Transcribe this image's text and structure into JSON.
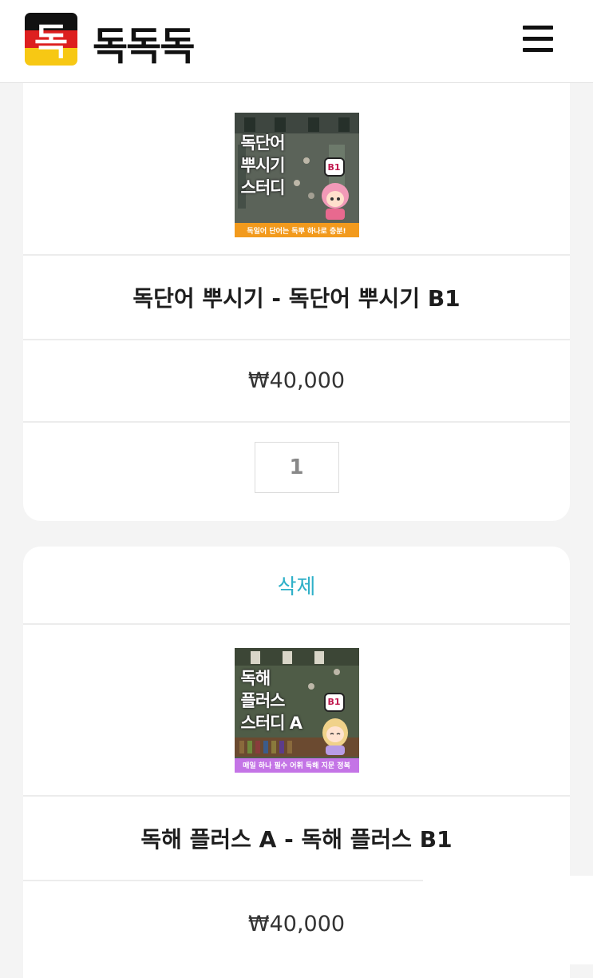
{
  "header": {
    "logo_glyph": "독",
    "brand": "독독독",
    "menu_icon": "hamburger-menu-icon",
    "colors": {
      "black": "#111111",
      "red": "#dd1f1f",
      "gold": "#f7c814"
    }
  },
  "items": [
    {
      "thumbnail": {
        "lines": [
          "독단어",
          "뿌시기",
          "스터디"
        ],
        "level": "B1",
        "banner": "독일어 단어는 독뿌 하나로 충분!",
        "banner_color": "#f29a1d"
      },
      "title": "독단어 뿌시기 - 독단어 뿌시기 B1",
      "price": "₩40,000",
      "quantity": "1"
    },
    {
      "delete_label": "삭제",
      "thumbnail": {
        "lines": [
          "독해",
          "플러스",
          "스터디 A"
        ],
        "level": "B1",
        "banner": "매일 하나 필수 어휘 독해 지문 정복",
        "banner_color": "#c474e6"
      },
      "title": "독해 플러스 A - 독해 플러스 B1",
      "price": "₩40,000"
    }
  ]
}
